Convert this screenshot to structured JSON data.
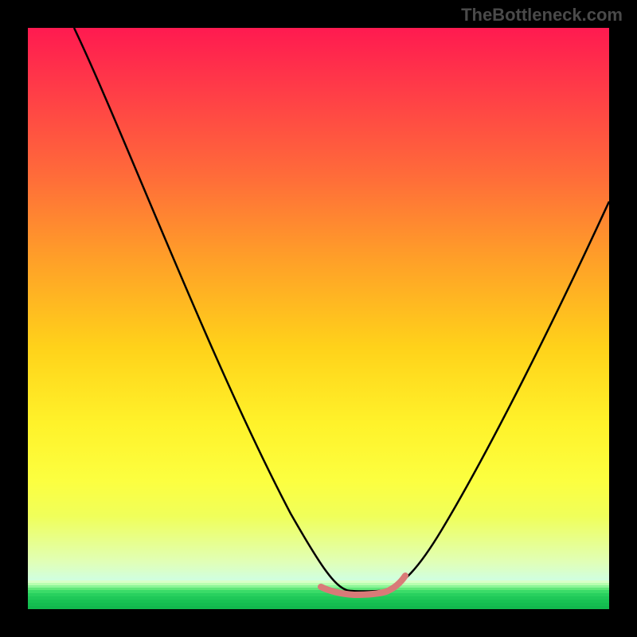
{
  "watermark": "TheBottleneck.com",
  "chart_data": {
    "type": "line",
    "title": "",
    "xlabel": "",
    "ylabel": "",
    "xlim": [
      0,
      100
    ],
    "ylim": [
      0,
      100
    ],
    "series": [
      {
        "name": "curve",
        "color": "#000000",
        "x": [
          8,
          12,
          18,
          24,
          30,
          36,
          42,
          46,
          50,
          53,
          56,
          59,
          62,
          65,
          70,
          76,
          82,
          88,
          94,
          100
        ],
        "y": [
          100,
          91,
          79,
          67,
          55,
          43,
          31,
          22,
          14,
          8,
          5,
          3.5,
          4,
          6,
          12,
          22,
          34,
          46,
          58,
          70
        ]
      },
      {
        "name": "highlight",
        "color": "#d97a78",
        "x": [
          50,
          52,
          54,
          56,
          58,
          60,
          62,
          64
        ],
        "y": [
          4.2,
          3.6,
          3.4,
          3.3,
          3.4,
          3.6,
          4.4,
          6.0
        ]
      }
    ],
    "background_gradient": {
      "top": "#ff1a50",
      "mid": "#ffd21a",
      "bottom": "#18c85a"
    }
  }
}
